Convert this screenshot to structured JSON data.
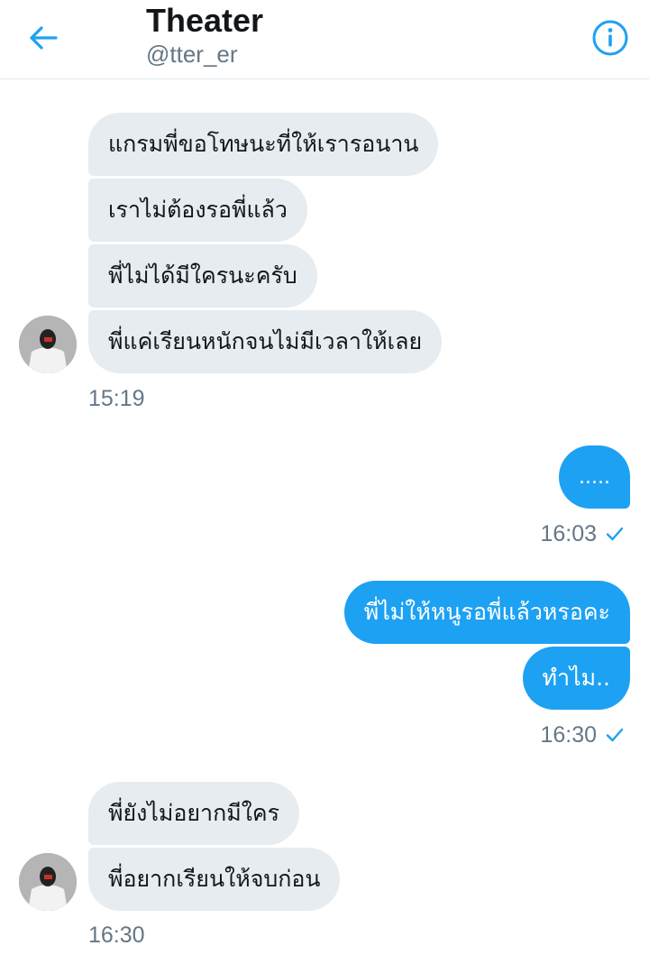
{
  "header": {
    "title": "Theater",
    "handle": "@tter_er",
    "back_icon": "arrow-left-icon",
    "info_icon": "info-icon",
    "accent_color": "#1da1f2"
  },
  "messages": [
    {
      "dir": "in",
      "text": "แกรมพี่ขอโทษนะที่ให้เรารอนาน"
    },
    {
      "dir": "in",
      "text": "เราไม่ต้องรอพี่แล้ว"
    },
    {
      "dir": "in",
      "text": "พี่ไม่ได้มีใครนะครับ"
    },
    {
      "dir": "in",
      "text": "พี่แค่เรียนหนักจนไม่มีเวลาให้เลย"
    },
    {
      "dir": "out",
      "text": "....."
    },
    {
      "dir": "out",
      "text": "พี่ไม่ให้หนูรอพี่แล้วหรอคะ"
    },
    {
      "dir": "out",
      "text": "ทำไม.."
    },
    {
      "dir": "in",
      "text": "พี่ยังไม่อยากมีใคร"
    },
    {
      "dir": "in",
      "text": "พี่อยากเรียนให้จบก่อน"
    }
  ],
  "timestamps": [
    "15:19",
    "16:03",
    "16:30",
    "16:30"
  ],
  "colors": {
    "incoming_bubble": "#e6ecf0",
    "outgoing_bubble": "#1da1f2",
    "timestamp": "#657786",
    "read_check": "#1da1f2"
  }
}
